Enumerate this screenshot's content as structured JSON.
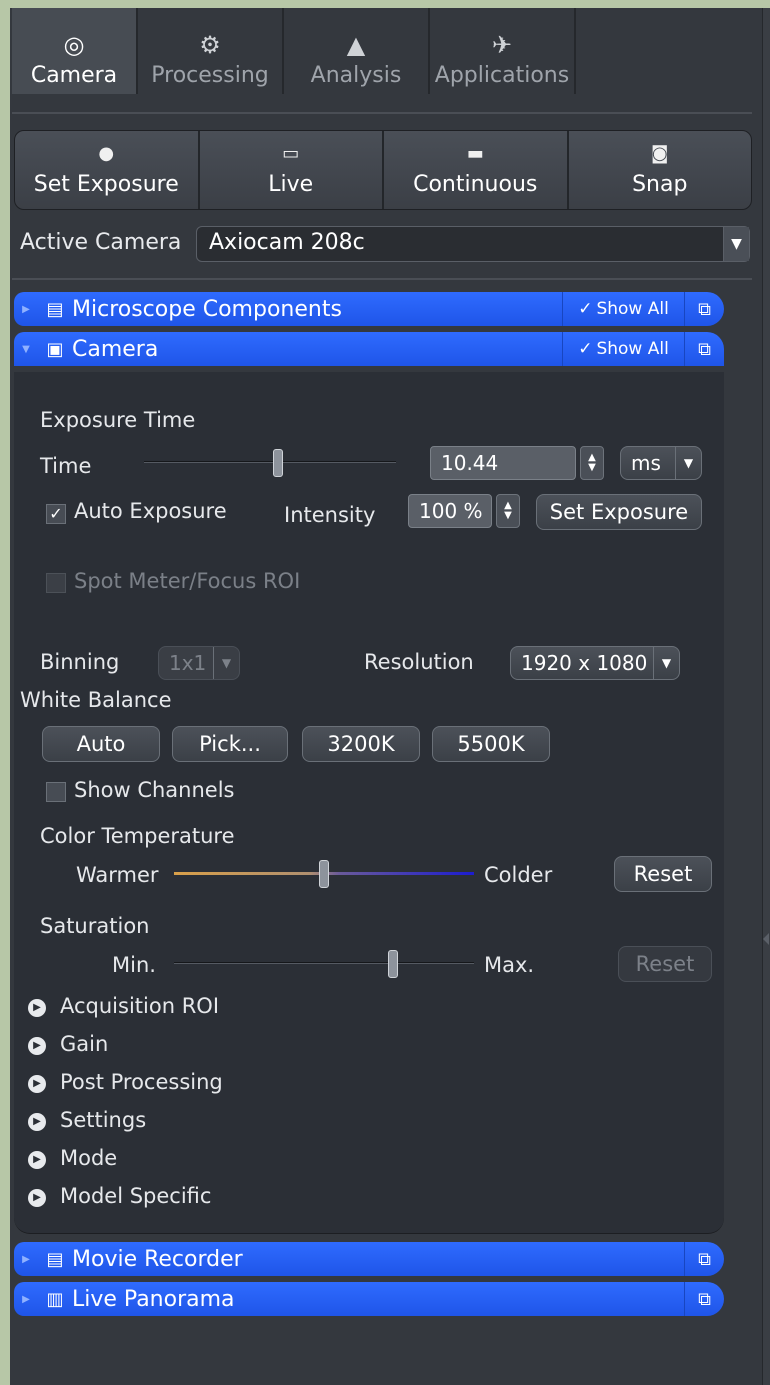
{
  "tabs": [
    {
      "label": "Camera",
      "icon": "camera-icon"
    },
    {
      "label": "Processing",
      "icon": "gear-icon"
    },
    {
      "label": "Analysis",
      "icon": "histogram-icon"
    },
    {
      "label": "Applications",
      "icon": "satellite-icon"
    }
  ],
  "actions": {
    "set_exposure": "Set Exposure",
    "live": "Live",
    "continuous": "Continuous",
    "snap": "Snap"
  },
  "active_camera": {
    "label": "Active Camera",
    "value": "Axiocam 208c"
  },
  "sections": {
    "microscope": {
      "title": "Microscope Components",
      "show_all": "Show All"
    },
    "camera": {
      "title": "Camera",
      "show_all": "Show All"
    },
    "movie": {
      "title": "Movie Recorder"
    },
    "panorama": {
      "title": "Live Panorama"
    }
  },
  "exposure": {
    "heading": "Exposure Time",
    "time_label": "Time",
    "time_value": "10.44",
    "time_unit": "ms",
    "time_slider_fraction": 0.53,
    "auto_exposure": "Auto Exposure",
    "auto_exposure_checked": true,
    "intensity_label": "Intensity",
    "intensity_value": "100 %",
    "set_exposure_button": "Set Exposure",
    "spot_meter": "Spot Meter/Focus ROI"
  },
  "binning": {
    "label": "Binning",
    "value": "1x1"
  },
  "resolution": {
    "label": "Resolution",
    "value": "1920 x 1080"
  },
  "white_balance": {
    "heading": "White Balance",
    "buttons": [
      "Auto",
      "Pick...",
      "3200K",
      "5500K"
    ],
    "show_channels": "Show Channels"
  },
  "color_temperature": {
    "heading": "Color Temperature",
    "min_label": "Warmer",
    "max_label": "Colder",
    "slider_fraction": 0.5,
    "reset": "Reset"
  },
  "saturation": {
    "heading": "Saturation",
    "min_label": "Min.",
    "max_label": "Max.",
    "slider_fraction": 0.73,
    "reset": "Reset"
  },
  "subsections": [
    "Acquisition ROI",
    "Gain",
    "Post Processing",
    "Settings",
    "Mode",
    "Model Specific"
  ],
  "colors": {
    "accent": "#2563ff",
    "panel": "#2b2f36",
    "background": "#34383e"
  }
}
